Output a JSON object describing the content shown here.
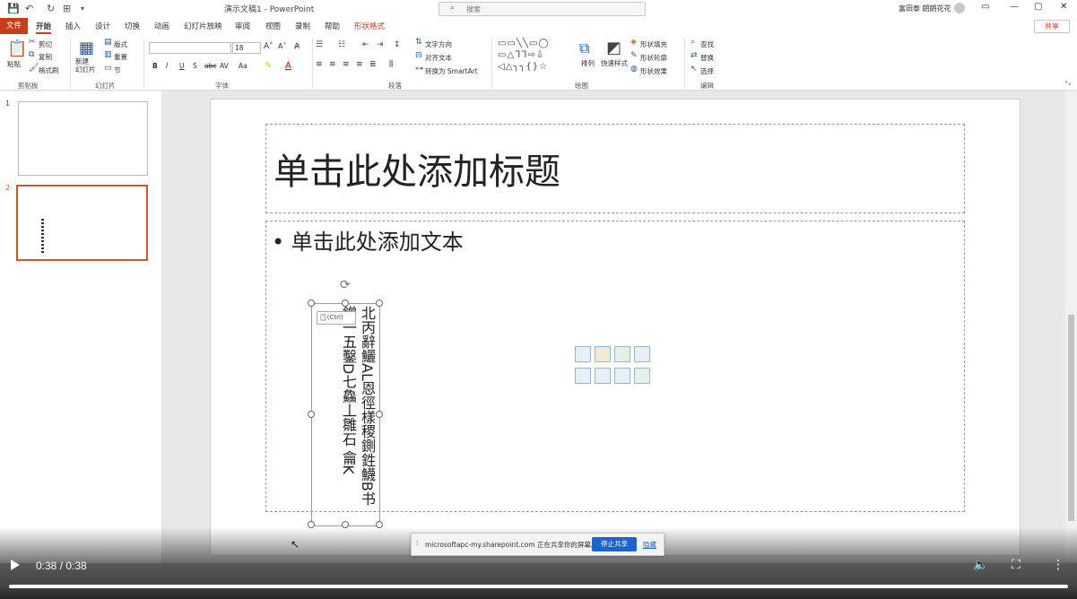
{
  "titlebar": {
    "doc_title": "演示文稿1  -  PowerPoint",
    "search_placeholder": "搜索",
    "user_name": "富田泰 朗朗花花",
    "min": "—",
    "max": "▢",
    "close": "✕"
  },
  "tabs": {
    "file": "文件",
    "home": "开始",
    "insert": "插入",
    "design": "设计",
    "transitions": "切换",
    "animations": "动画",
    "slideshow": "幻灯片放映",
    "review": "审阅",
    "view": "视图",
    "record": "录制",
    "help": "帮助",
    "shape_format": "形状格式",
    "share": "共享"
  },
  "ribbon": {
    "clipboard": {
      "paste": "粘贴",
      "cut": "剪切",
      "copy": "复制",
      "format_painter": "格式刷",
      "label": "剪贴板"
    },
    "slides": {
      "new_slide": "新建\n幻灯片",
      "layout": "版式",
      "reset": "重置",
      "section": "节",
      "label": "幻灯片"
    },
    "font": {
      "font_name": "",
      "font_size": "18",
      "label": "字体"
    },
    "paragraph": {
      "text_direction": "文字方向",
      "align_text": "对齐文本",
      "smartart": "转换为 SmartArt",
      "label": "段落"
    },
    "drawing": {
      "arrange": "排列",
      "quick_styles": "快速样式",
      "shape_fill": "形状填充",
      "shape_outline": "形状轮廓",
      "shape_effects": "形状效果",
      "label": "绘图"
    },
    "editing": {
      "find": "查找",
      "replace": "替换",
      "select": "选择",
      "label": "编辑"
    }
  },
  "slide_pane": {
    "slide1_num": "1",
    "slide2_num": "2"
  },
  "slide": {
    "title_placeholder": "单击此处添加标题",
    "body_placeholder": "单击此处添加文本",
    "paste_tag": "(Ctrl)",
    "vertical_col_right": "北丙辭鱺AL恩徑樣稷鍘鉎鱴B书",
    "vertical_col_left": "鏳一五鑿D七鱻丄雛石 龠K"
  },
  "share_banner": {
    "message": "microsoftapc-my.sharepoint.com 正在共享你的屏幕。",
    "stop_button": "停止共享",
    "hide_link": "隐藏"
  },
  "video": {
    "time": "0:38 / 0:38",
    "progress": 1.0
  }
}
